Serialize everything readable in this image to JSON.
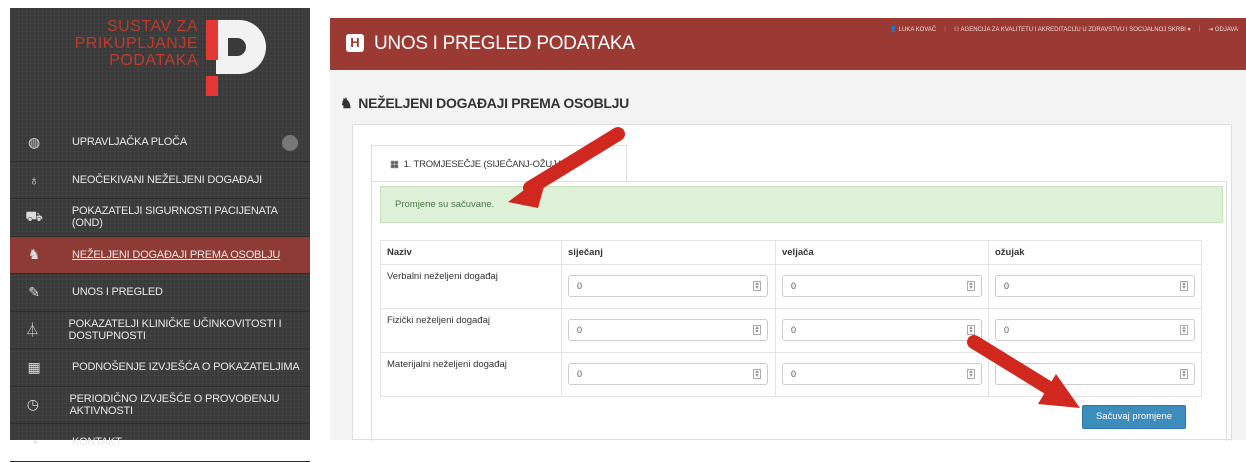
{
  "logo": {
    "line1": "SUSTAV ZA",
    "line2": "PRIKUPLJANJE",
    "line3": "PODATAKA"
  },
  "sidebar": {
    "items": [
      {
        "label": "UPRAVLJAČKA PLOČA",
        "icon": "dashboard-icon",
        "glyph": "◍"
      },
      {
        "label": "NEOČEKIVANI NEŽELJENI DOGAĐAJI",
        "icon": "stethoscope-icon",
        "glyph": "♁"
      },
      {
        "label": "POKAZATELJI SIGURNOSTI PACIJENATA (OND)",
        "icon": "ambulance-icon",
        "glyph": "⛟"
      },
      {
        "label": "NEŽELJENI DOGAĐAJI PREMA OSOBLJU",
        "icon": "staff-icon",
        "glyph": "♞"
      },
      {
        "label": "UNOS I PREGLED",
        "icon": "edit-icon",
        "glyph": "✎"
      },
      {
        "label": "POKAZATELJI KLINIČKE UČINKOVITOSTI I DOSTUPNOSTI",
        "icon": "flask-icon",
        "glyph": "⏃"
      },
      {
        "label": "PODNOŠENJE IZVJEŠĆA O POKAZATELJIMA",
        "icon": "table-icon",
        "glyph": "▦"
      },
      {
        "label": "PERIODIČNO IZVJEŠĆE O PROVOĐENJU AKTIVNOSTI",
        "icon": "clock-icon",
        "glyph": "◷"
      },
      {
        "label": "KONTAKT",
        "icon": "chat-icon",
        "glyph": "◔"
      }
    ]
  },
  "header": {
    "icon_letter": "H",
    "title": "UNOS I PREGLED PODATAKA",
    "user": "LUKA KOVAČ",
    "agency": "AGENCIJA ZA KVALITETU I AKREDITACIJU U ZDRAVSTVU I SOCIJALNOJ SKRBI",
    "logout": "ODJAVA"
  },
  "page": {
    "title": "NEŽELJENI DOGAĐAJI PREMA OSOBLJU",
    "tab": "1. TROMJESEČJE (SIJEČANJ-OŽUJAK)",
    "alert": "Promjene su sačuvane.",
    "save_label": "Sačuvaj promjene"
  },
  "table": {
    "headers": [
      "Naziv",
      "siječanj",
      "veljača",
      "ožujak"
    ],
    "rows": [
      {
        "label": "Verbalni neželjeni događaj",
        "values": [
          "0",
          "0",
          "0"
        ]
      },
      {
        "label": "Fizički neželjeni događaj",
        "values": [
          "0",
          "0",
          "0"
        ]
      },
      {
        "label": "Materijalni neželjeni događaj",
        "values": [
          "0",
          "0",
          ""
        ]
      }
    ]
  },
  "colors": {
    "header": "#9b3a32",
    "active_nav": "#8e3b35",
    "button": "#3c8dbc",
    "alert_bg": "#dff0d8",
    "arrow": "#d0281f"
  }
}
